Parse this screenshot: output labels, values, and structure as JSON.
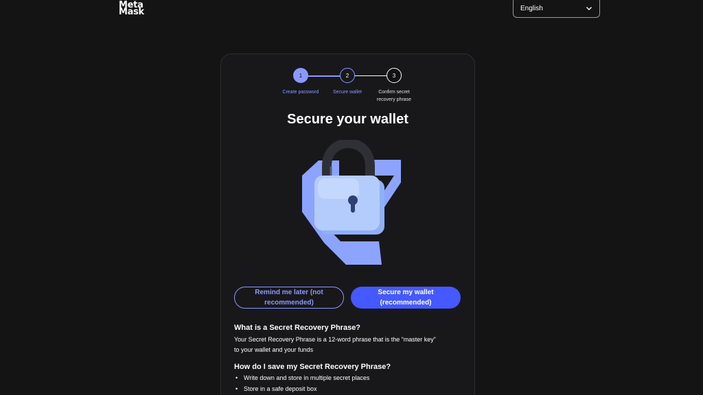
{
  "header": {
    "logo_line1": "Meta",
    "logo_line2": "Mask",
    "language": "English"
  },
  "stepper": {
    "steps": [
      {
        "number": "1",
        "label": "Create password"
      },
      {
        "number": "2",
        "label": "Secure wallet"
      },
      {
        "number": "3",
        "label_line1": "Confirm secret",
        "label_line2": "recovery phrase"
      }
    ]
  },
  "main": {
    "title": "Secure your wallet",
    "remind_later_line1": "Remind me later (not",
    "remind_later_line2": "recommended)",
    "secure_line1": "Secure my wallet",
    "secure_line2": "(recommended)",
    "faq_heading_1": "What is a Secret Recovery Phrase?",
    "faq_text_1_line1": "Your Secret Recovery Phrase is a 12-word phrase that is the “master key”",
    "faq_text_1_line2": "to your wallet and your funds",
    "faq_heading_2": "How do I save my Secret Recovery Phrase?",
    "save_tips": [
      "Write down and store in multiple secret places",
      "Store in a safe deposit box"
    ]
  },
  "colors": {
    "background": "#141414",
    "card": "#18181b",
    "accent": "#8b99ff",
    "primary_button": "#4459ff"
  },
  "icons": [
    "chevron-down-icon",
    "padlock-illustration"
  ]
}
